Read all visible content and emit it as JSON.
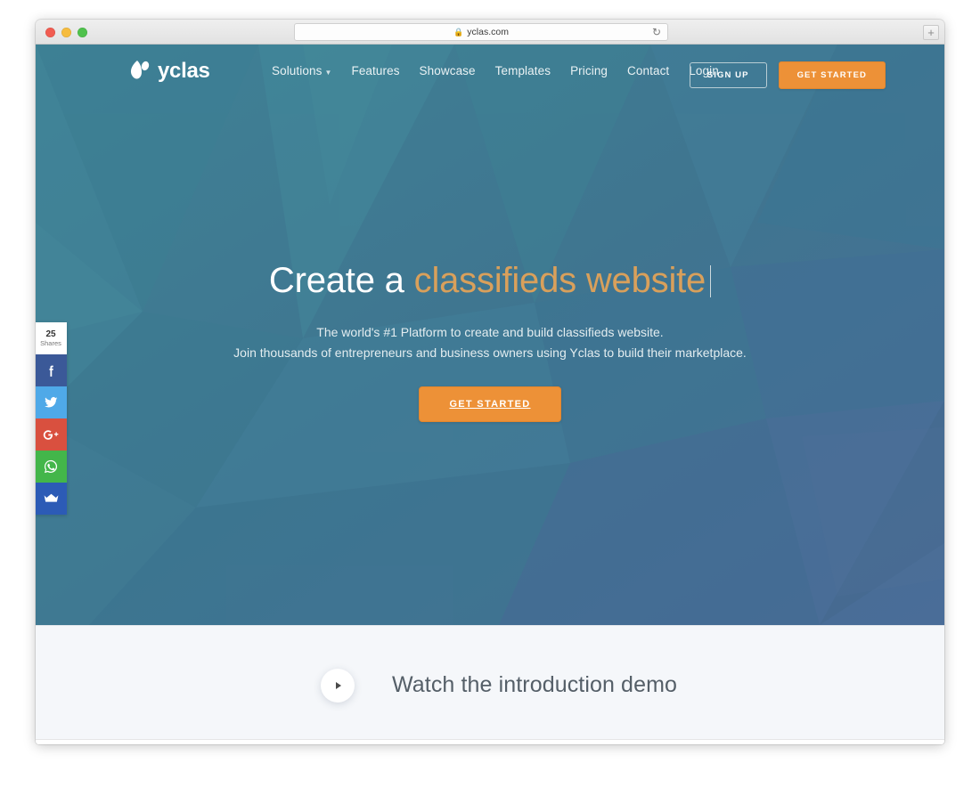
{
  "browser": {
    "address": "yclas.com",
    "lock_icon": "lock-icon",
    "reload_icon": "reload-icon",
    "newtab_label": "+",
    "traffic_lights": [
      "close-red",
      "minimize-yellow",
      "maximize-green"
    ]
  },
  "header": {
    "logo_text": "yclas",
    "logo_icon": "yclas-leaf-mark",
    "nav": [
      {
        "label": "Solutions",
        "has_dropdown": true,
        "caret": "▾"
      },
      {
        "label": "Features",
        "has_dropdown": false
      },
      {
        "label": "Showcase",
        "has_dropdown": false
      },
      {
        "label": "Templates",
        "has_dropdown": false
      },
      {
        "label": "Pricing",
        "has_dropdown": false
      },
      {
        "label": "Contact",
        "has_dropdown": false
      },
      {
        "label": "Login",
        "has_dropdown": false
      }
    ],
    "signup_label": "SIGN UP",
    "getstarted_label": "GET STARTED"
  },
  "hero": {
    "headline_static": "Create a ",
    "headline_typed": "classifieds website",
    "sub_line1": "The world's #1 Platform to create and build classifieds website.",
    "sub_line2": "Join thousands of entrepreneurs and business owners using Yclas to build their marketplace.",
    "cta_label": "GET STARTED"
  },
  "social": {
    "count": "25",
    "count_label": "Shares",
    "items": [
      {
        "name": "facebook",
        "icon": "facebook-icon",
        "color": "#3b5998"
      },
      {
        "name": "twitter",
        "icon": "twitter-icon",
        "color": "#4fa9e8"
      },
      {
        "name": "googleplus",
        "icon": "google-plus-icon",
        "color": "#d9503f"
      },
      {
        "name": "whatsapp",
        "icon": "whatsapp-icon",
        "color": "#43b64a"
      },
      {
        "name": "crown",
        "icon": "crown-icon",
        "color": "#2c5bb6"
      }
    ]
  },
  "demo": {
    "play_icon": "play-icon",
    "title": "Watch the introduction demo"
  },
  "colors": {
    "hero_teal": "#3d7e90",
    "hero_blue": "#4a6d96",
    "accent_orange": "#ed9137",
    "headline_accent": "#d9a05b",
    "demo_bg": "#f5f7fa"
  }
}
